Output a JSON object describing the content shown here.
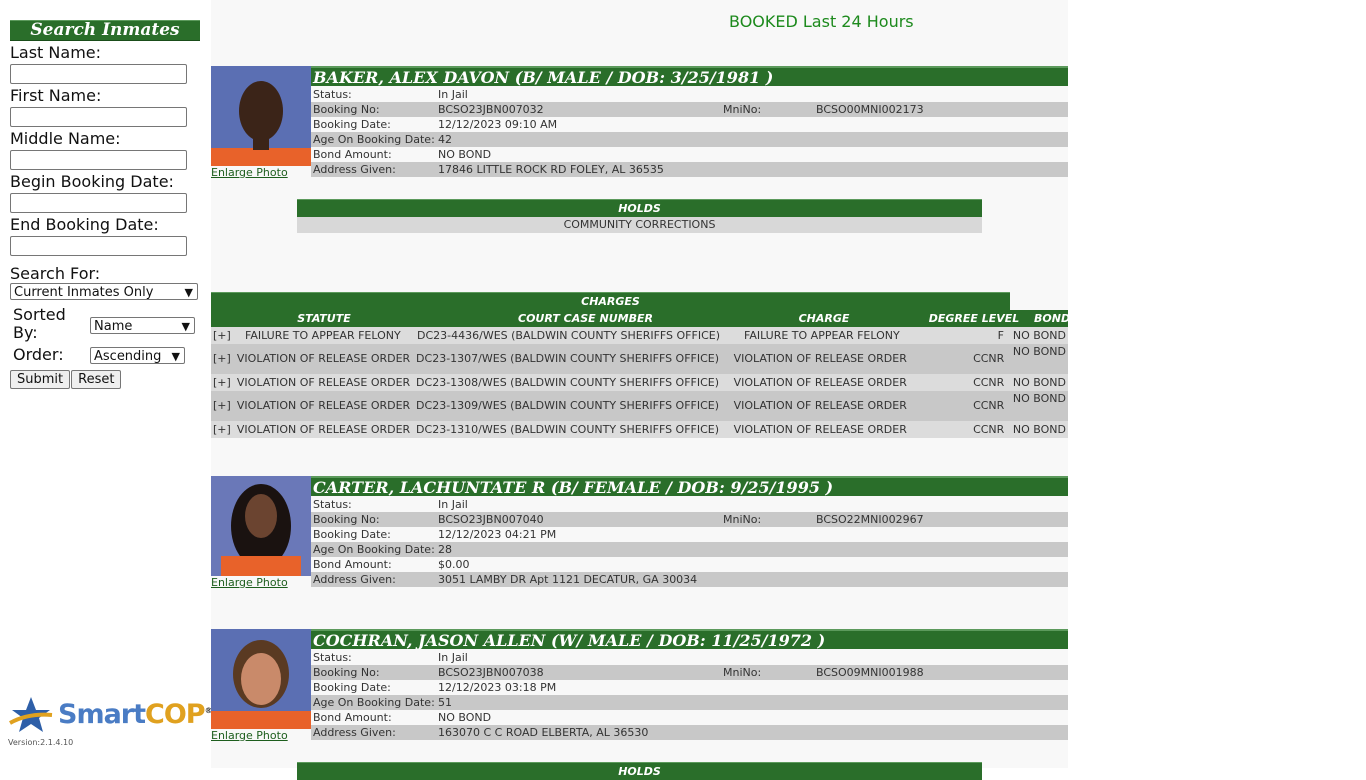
{
  "sidebar": {
    "header": "Search Inmates",
    "fields": [
      {
        "label": "Last Name:",
        "value": ""
      },
      {
        "label": "First Name:",
        "value": ""
      },
      {
        "label": "Middle Name:",
        "value": ""
      },
      {
        "label": "Begin Booking Date:",
        "value": ""
      },
      {
        "label": "End Booking Date:",
        "value": ""
      }
    ],
    "search_for_label": "Search For:",
    "search_for_value": "Current Inmates Only",
    "sorted_by_label": "Sorted By:",
    "sorted_by_value": "Name",
    "order_label": "Order:",
    "order_value": "Ascending",
    "submit_label": "Submit",
    "reset_label": "Reset",
    "logo": {
      "part1": "Smart",
      "part2": "COP",
      "reg": "®"
    },
    "version": "Version:2.1.4.10"
  },
  "page_title": "BOOKED Last 24 Hours",
  "labels": {
    "status": "Status:",
    "booking_no": "Booking No:",
    "mni_no": "MniNo:",
    "booking_date": "Booking Date:",
    "age": "Age On Booking Date:",
    "bond": "Bond Amount:",
    "address": "Address Given:",
    "enlarge": "Enlarge Photo",
    "holds": "HOLDS",
    "charges": "CHARGES",
    "col_statute": "STATUTE",
    "col_case": "COURT CASE NUMBER",
    "col_charge": "CHARGE",
    "col_degree": "DEGREE LEVEL",
    "col_bond": "BOND"
  },
  "inmates": [
    {
      "header": "BAKER, ALEX DAVON   (B/ MALE / DOB: 3/25/1981 )",
      "status": "In Jail",
      "booking_no": "BCSO23JBN007032",
      "mni_no": "BCSO00MNI002173",
      "booking_date": "12/12/2023 09:10 AM",
      "age": "42",
      "bond": "NO BOND",
      "address": "17846 LITTLE ROCK RD FOLEY, AL 36535",
      "holds": [
        "COMMUNITY CORRECTIONS"
      ],
      "charges": [
        {
          "plus": "[+]",
          "statute": "FAILURE TO APPEAR FELONY",
          "case": "DC23-4436/WES (BALDWIN COUNTY SHERIFFS OFFICE)",
          "charge": "FAILURE TO APPEAR FELONY",
          "degree": "F",
          "bond": "NO BOND"
        },
        {
          "plus": "[+]",
          "statute": "VIOLATION OF RELEASE ORDER",
          "case": "DC23-1307/WES (BALDWIN COUNTY SHERIFFS OFFICE)",
          "charge": "VIOLATION OF RELEASE ORDER",
          "degree": "CCNR",
          "bond": "NO BOND"
        },
        {
          "plus": "[+]",
          "statute": "VIOLATION OF RELEASE ORDER",
          "case": "DC23-1308/WES (BALDWIN COUNTY SHERIFFS OFFICE)",
          "charge": "VIOLATION OF RELEASE ORDER",
          "degree": "CCNR",
          "bond": "NO BOND"
        },
        {
          "plus": "[+]",
          "statute": "VIOLATION OF RELEASE ORDER",
          "case": "DC23-1309/WES (BALDWIN COUNTY SHERIFFS OFFICE)",
          "charge": "VIOLATION OF RELEASE ORDER",
          "degree": "CCNR",
          "bond": "NO BOND"
        },
        {
          "plus": "[+]",
          "statute": "VIOLATION OF RELEASE ORDER",
          "case": "DC23-1310/WES (BALDWIN COUNTY SHERIFFS OFFICE)",
          "charge": "VIOLATION OF RELEASE ORDER",
          "degree": "CCNR",
          "bond": "NO BOND"
        }
      ]
    },
    {
      "header": "CARTER, LACHUNTATE R   (B/ FEMALE / DOB: 9/25/1995 )",
      "status": "In Jail",
      "booking_no": "BCSO23JBN007040",
      "mni_no": "BCSO22MNI002967",
      "booking_date": "12/12/2023 04:21 PM",
      "age": "28",
      "bond": "$0.00",
      "address": "3051 LAMBY DR Apt 1121 DECATUR, GA 30034"
    },
    {
      "header": "COCHRAN, JASON ALLEN   (W/ MALE / DOB: 11/25/1972 )",
      "status": "In Jail",
      "booking_no": "BCSO23JBN007038",
      "mni_no": "BCSO09MNI001988",
      "booking_date": "12/12/2023 03:18 PM",
      "age": "51",
      "bond": "NO BOND",
      "address": "163070 C C ROAD ELBERTA, AL 36530",
      "holds_header_partial": "HOLDS"
    }
  ]
}
